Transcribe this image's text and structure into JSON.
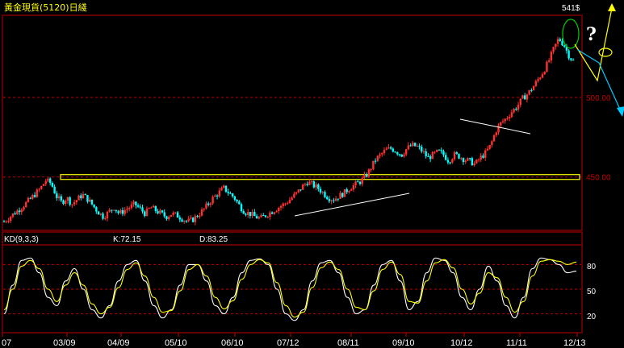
{
  "title": "黃金現貨(5120)日綫",
  "indicator": {
    "name": "KD(9,3,3)",
    "k_label": "K:72.15",
    "d_label": "D:83.25",
    "levels": [
      "80",
      "50",
      "20"
    ]
  },
  "annotations": {
    "peak_label": "541$",
    "question": "?"
  },
  "colors": {
    "up": "#ff3030",
    "down": "#00ffff",
    "grid": "#c00000",
    "frame": "#c00000",
    "support_box": "#ffff00",
    "k_line": "#ffffff",
    "d_line": "#ffff00"
  },
  "chart_data": {
    "type": "line",
    "x_ticks": [
      "07",
      "03/09",
      "04/09",
      "05/10",
      "06/10",
      "07/12",
      "08/11",
      "09/10",
      "10/12",
      "11/11",
      "12/13"
    ],
    "price_axis": {
      "ticks": [
        "500.00",
        "450.00"
      ],
      "range": [
        418,
        550
      ]
    },
    "price_series": {
      "name": "price",
      "points": [
        [
          0,
          422
        ],
        [
          3,
          430
        ],
        [
          5,
          436
        ],
        [
          7,
          443
        ],
        [
          8,
          448
        ],
        [
          9,
          446
        ],
        [
          10,
          438
        ],
        [
          11,
          434
        ],
        [
          12,
          437
        ],
        [
          13,
          433
        ],
        [
          14,
          436
        ],
        [
          15,
          439
        ],
        [
          16,
          436
        ],
        [
          17,
          432
        ],
        [
          18,
          428
        ],
        [
          19,
          425
        ],
        [
          20,
          428
        ],
        [
          21,
          431
        ],
        [
          22,
          427
        ],
        [
          23,
          429
        ],
        [
          24,
          431
        ],
        [
          25,
          433
        ],
        [
          26,
          430
        ],
        [
          27,
          427
        ],
        [
          28,
          431
        ],
        [
          29,
          429
        ],
        [
          30,
          427
        ],
        [
          31,
          425
        ],
        [
          32,
          427
        ],
        [
          33,
          426
        ],
        [
          34,
          424
        ],
        [
          35,
          422
        ],
        [
          36,
          423
        ],
        [
          37,
          426
        ],
        [
          38,
          429
        ],
        [
          39,
          433
        ],
        [
          40,
          437
        ],
        [
          41,
          440
        ],
        [
          42,
          443
        ],
        [
          43,
          440
        ],
        [
          44,
          437
        ],
        [
          45,
          432
        ],
        [
          46,
          428
        ],
        [
          47,
          427
        ],
        [
          48,
          425
        ],
        [
          49,
          424
        ],
        [
          50,
          426
        ],
        [
          51,
          428
        ],
        [
          52,
          430
        ],
        [
          53,
          432
        ],
        [
          54,
          434
        ],
        [
          55,
          437
        ],
        [
          56,
          440
        ],
        [
          57,
          444
        ],
        [
          58,
          447
        ],
        [
          59,
          445
        ],
        [
          60,
          443
        ],
        [
          61,
          440
        ],
        [
          62,
          437
        ],
        [
          63,
          436
        ],
        [
          64,
          438
        ],
        [
          65,
          440
        ],
        [
          66,
          443
        ],
        [
          67,
          445
        ],
        [
          68,
          447
        ],
        [
          69,
          450
        ],
        [
          70,
          455
        ],
        [
          71,
          461
        ],
        [
          72,
          464
        ],
        [
          73,
          467
        ],
        [
          74,
          468
        ],
        [
          75,
          466
        ],
        [
          76,
          464
        ],
        [
          77,
          468
        ],
        [
          78,
          470
        ],
        [
          79,
          469
        ],
        [
          80,
          466
        ],
        [
          81,
          462
        ],
        [
          82,
          464
        ],
        [
          83,
          466
        ],
        [
          84,
          464
        ],
        [
          85,
          460
        ],
        [
          86,
          464
        ],
        [
          87,
          463
        ],
        [
          88,
          461
        ],
        [
          89,
          460
        ],
        [
          90,
          458
        ],
        [
          91,
          462
        ],
        [
          92,
          465
        ],
        [
          93,
          470
        ],
        [
          94,
          479
        ],
        [
          95,
          484
        ],
        [
          96,
          487
        ],
        [
          97,
          491
        ],
        [
          98,
          494
        ],
        [
          99,
          499
        ],
        [
          100,
          502
        ],
        [
          101,
          506
        ],
        [
          102,
          511
        ],
        [
          103,
          516
        ],
        [
          104,
          522
        ],
        [
          105,
          530
        ],
        [
          106,
          537
        ],
        [
          107,
          533
        ],
        [
          108,
          526
        ],
        [
          109,
          522
        ]
      ],
      "x_range": [
        0,
        110
      ]
    },
    "kd_series": [
      {
        "name": "K",
        "values": [
          20,
          55,
          85,
          88,
          70,
          40,
          30,
          60,
          75,
          50,
          25,
          15,
          30,
          60,
          80,
          85,
          60,
          30,
          15,
          25,
          55,
          80,
          80,
          60,
          30,
          20,
          40,
          70,
          85,
          87,
          80,
          50,
          20,
          12,
          25,
          60,
          82,
          85,
          70,
          40,
          20,
          25,
          55,
          80,
          85,
          60,
          25,
          35,
          70,
          88,
          85,
          70,
          40,
          25,
          50,
          78,
          60,
          30,
          15,
          40,
          75,
          88,
          86,
          80,
          70,
          72
        ]
      },
      {
        "name": "D",
        "values": [
          25,
          50,
          78,
          85,
          75,
          50,
          35,
          55,
          70,
          55,
          32,
          20,
          28,
          52,
          74,
          82,
          66,
          40,
          22,
          24,
          48,
          74,
          80,
          66,
          40,
          26,
          36,
          62,
          80,
          86,
          82,
          58,
          30,
          16,
          22,
          52,
          76,
          83,
          74,
          50,
          28,
          25,
          48,
          74,
          83,
          68,
          35,
          33,
          60,
          82,
          86,
          76,
          50,
          32,
          45,
          70,
          64,
          40,
          22,
          35,
          66,
          84,
          86,
          84,
          80,
          83
        ]
      }
    ],
    "kd_axis": {
      "range": [
        0,
        100
      ],
      "ticks": [
        80,
        50,
        20
      ]
    }
  }
}
